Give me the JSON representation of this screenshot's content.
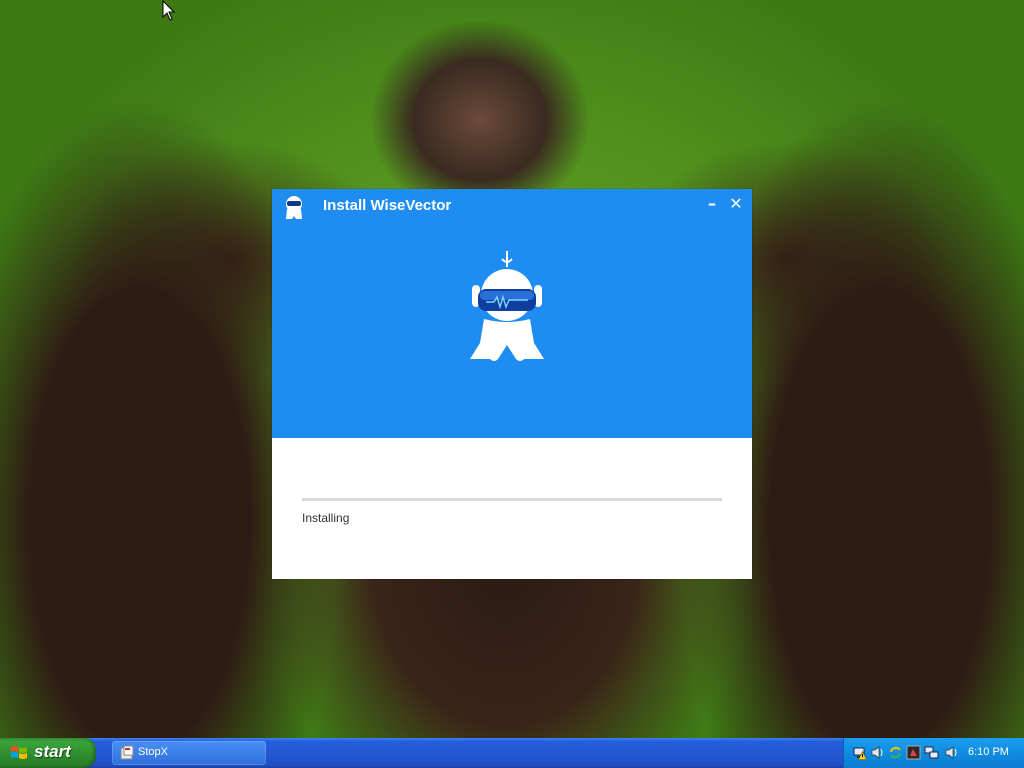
{
  "installer": {
    "title": "Install WiseVector",
    "minimize_icon": "minimize-icon",
    "close_icon": "close-icon",
    "status": "Installing",
    "progress": 0,
    "accent_color": "#1e8cf0"
  },
  "taskbar": {
    "start_label": "start",
    "tasks": [
      {
        "label": "StopX",
        "icon": "app-icon"
      }
    ],
    "tray_icons": [
      "network-icon",
      "warning-icon",
      "volume-icon",
      "refresh-icon",
      "security-icon",
      "network-connection-icon",
      "speaker-icon"
    ],
    "clock": "6:10 PM"
  }
}
